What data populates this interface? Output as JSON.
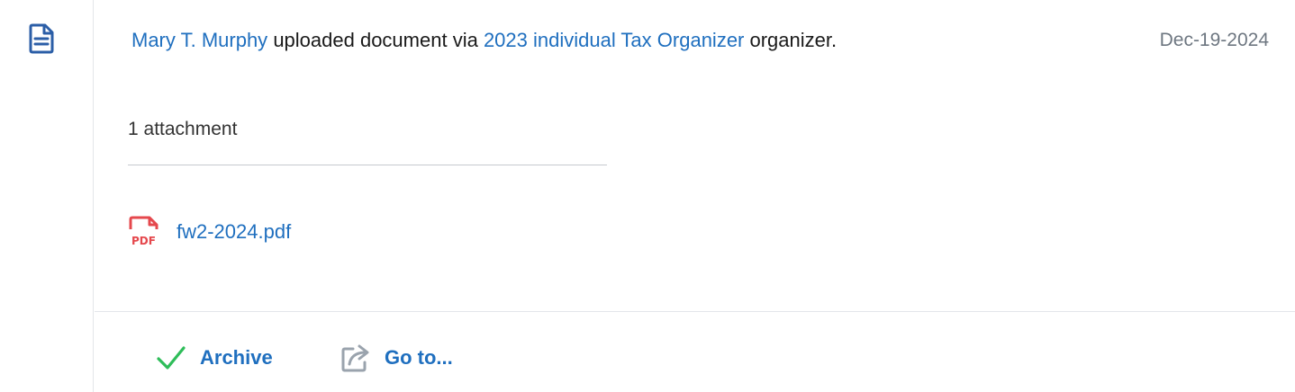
{
  "activity": {
    "actor_name": "Mary T. Murphy",
    "text_uploaded": "uploaded document via",
    "organizer_name": "2023 individual Tax Organizer",
    "text_suffix": "organizer.",
    "date": "Dec-19-2024",
    "icon": "document-icon"
  },
  "attachments": {
    "count_label": "1 attachment",
    "files": [
      {
        "name": "fw2-2024.pdf",
        "icon": "pdf-icon"
      }
    ]
  },
  "actions": {
    "archive_label": "Archive",
    "archive_icon": "checkmark-icon",
    "goto_label": "Go to...",
    "goto_icon": "external-link-icon"
  },
  "colors": {
    "link": "#1f6fbf",
    "archive_check": "#2ebd59",
    "pdf_red": "#e5484d",
    "doc_icon": "#2b5ea7",
    "date": "#6e7781"
  }
}
